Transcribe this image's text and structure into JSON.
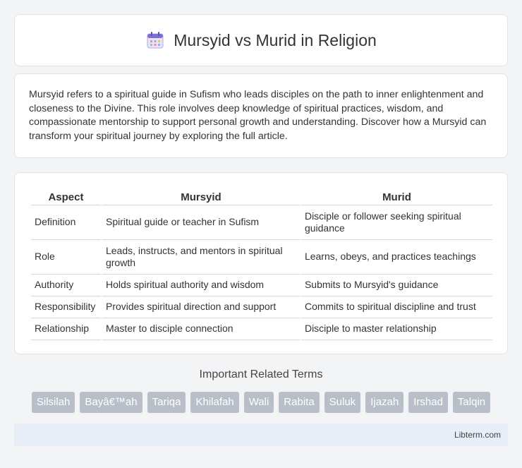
{
  "header": {
    "title": "Mursyid vs Murid in Religion",
    "icon": "calendar-icon"
  },
  "intro": {
    "text": "Mursyid refers to a spiritual guide in Sufism who leads disciples on the path to inner enlightenment and closeness to the Divine. This role involves deep knowledge of spiritual practices, wisdom, and compassionate mentorship to support personal growth and understanding. Discover how a Mursyid can transform your spiritual journey by exploring the full article."
  },
  "table": {
    "headers": [
      "Aspect",
      "Mursyid",
      "Murid"
    ],
    "rows": [
      [
        "Definition",
        "Spiritual guide or teacher in Sufism",
        "Disciple or follower seeking spiritual guidance"
      ],
      [
        "Role",
        "Leads, instructs, and mentors in spiritual growth",
        "Learns, obeys, and practices teachings"
      ],
      [
        "Authority",
        "Holds spiritual authority and wisdom",
        "Submits to Mursyid's guidance"
      ],
      [
        "Responsibility",
        "Provides spiritual direction and support",
        "Commits to spiritual discipline and trust"
      ],
      [
        "Relationship",
        "Master to disciple connection",
        "Disciple to master relationship"
      ]
    ]
  },
  "related": {
    "title": "Important Related Terms",
    "tags": [
      "Silsilah",
      "Bayâ€™ah",
      "Tariqa",
      "Khilafah",
      "Wali",
      "Rabita",
      "Suluk",
      "Ijazah",
      "Irshad",
      "Talqin"
    ]
  },
  "footer": {
    "text": "Libterm.com"
  }
}
